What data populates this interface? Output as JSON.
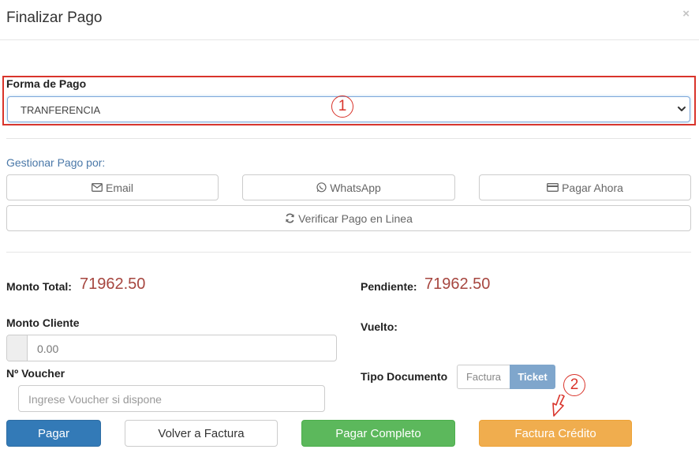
{
  "modal": {
    "title": "Finalizar Pago",
    "close_glyph": "×"
  },
  "payment_method": {
    "label": "Forma de Pago",
    "selected": "TRANFERENCIA",
    "marker": "1"
  },
  "manage": {
    "label": "Gestionar Pago por:",
    "email_label": "Email",
    "whatsapp_label": "WhatsApp",
    "pay_now_label": "Pagar Ahora",
    "verify_label": "Verificar Pago en Linea",
    "icons": [
      "envelope-icon",
      "whatsapp-icon",
      "credit-card-icon",
      "refresh-icon"
    ]
  },
  "totals": {
    "total_label": "Monto Total:",
    "total_value": "71962.50",
    "pending_label": "Pendiente:",
    "pending_value": "71962.50",
    "change_label": "Vuelto:"
  },
  "client_amount": {
    "label": "Monto Cliente",
    "value": "0.00"
  },
  "voucher": {
    "label": "Nº Voucher",
    "placeholder": "Ingrese Voucher si dispone"
  },
  "document_type": {
    "label": "Tipo Documento",
    "options": [
      "Factura",
      "Ticket"
    ],
    "selected": "Ticket"
  },
  "actions": {
    "pay_label": "Pagar",
    "back_label": "Volver a Factura",
    "pay_full_label": "Pagar Completo",
    "credit_invoice_label": "Factura Crédito",
    "marker": "2"
  },
  "colors": {
    "primary": "#337ab7",
    "success": "#5cb85c",
    "warning": "#f0ad4e",
    "annotation": "#d9342b",
    "amount": "#a6463f"
  }
}
